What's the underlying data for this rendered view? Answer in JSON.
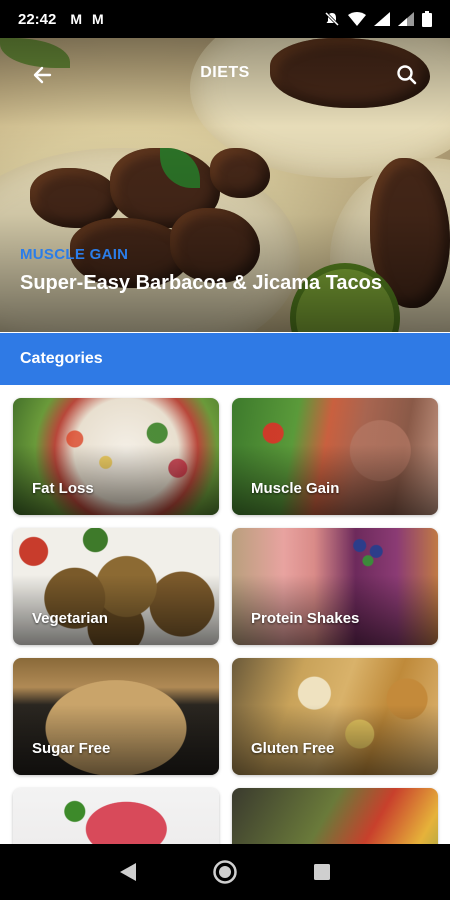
{
  "status_bar": {
    "time": "22:42",
    "app_icons": [
      "M",
      "M"
    ]
  },
  "app_bar": {
    "title": "DIETS"
  },
  "featured": {
    "tag": "MUSCLE GAIN",
    "title": "Super-Easy Barbacoa & Jicama Tacos"
  },
  "categories": {
    "header": "Categories",
    "items": [
      {
        "label": "Fat Loss"
      },
      {
        "label": "Muscle Gain"
      },
      {
        "label": "Vegetarian"
      },
      {
        "label": "Protein Shakes"
      },
      {
        "label": "Sugar Free"
      },
      {
        "label": "Gluten Free"
      },
      {
        "label": ""
      },
      {
        "label": ""
      }
    ]
  },
  "colors": {
    "accent_blue": "#2f7ae5",
    "tag_blue": "#2b7de9"
  }
}
